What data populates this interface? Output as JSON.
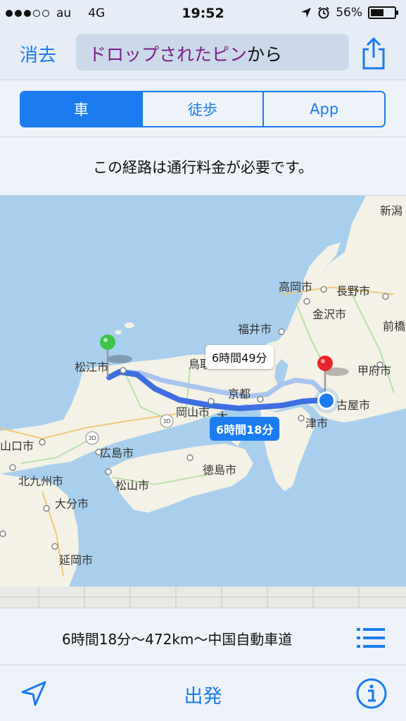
{
  "status": {
    "carrier": "au",
    "network": "4G",
    "time": "19:52",
    "battery": "56%",
    "battery_level": 0.56,
    "signal_bars": 3,
    "icons": [
      "location-arrow-icon",
      "alarm-clock-icon"
    ]
  },
  "nav": {
    "cancel": "消去",
    "route_accent": "ドロップされたピン",
    "route_rest": "から",
    "share_icon": "share-icon"
  },
  "modes": [
    {
      "label": "車",
      "active": true
    },
    {
      "label": "徒歩",
      "active": false
    },
    {
      "label": "App",
      "active": false
    }
  ],
  "notice": "この経路は通行料金が必要です。",
  "map": {
    "cities": [
      "新潟",
      "高岡市",
      "長野市",
      "金沢市",
      "福井市",
      "前橋",
      "甲府市",
      "松江市",
      "鳥取",
      "京都",
      "古屋市",
      "岡山市",
      "津市",
      "山口市",
      "広島市",
      "徳島市",
      "北九州市",
      "松山市",
      "大分市",
      "延岡市",
      "大"
    ],
    "route_alt_time": "6時間49分",
    "route_main_time": "6時間18分",
    "pin_start_color": "#3fc44a",
    "pin_end_color": "#e8252b",
    "route_color": "#3d6fe0"
  },
  "summary": {
    "text": "6時間18分〜472km〜中国自動車道",
    "list_icon": "list-icon"
  },
  "toolbar": {
    "start": "出発",
    "locate_icon": "location-arrow-icon",
    "info_icon": "info-icon"
  },
  "colors": {
    "accent": "#1b7cf0",
    "sea": "#a8d0ee",
    "land": "#f4f2e6"
  }
}
